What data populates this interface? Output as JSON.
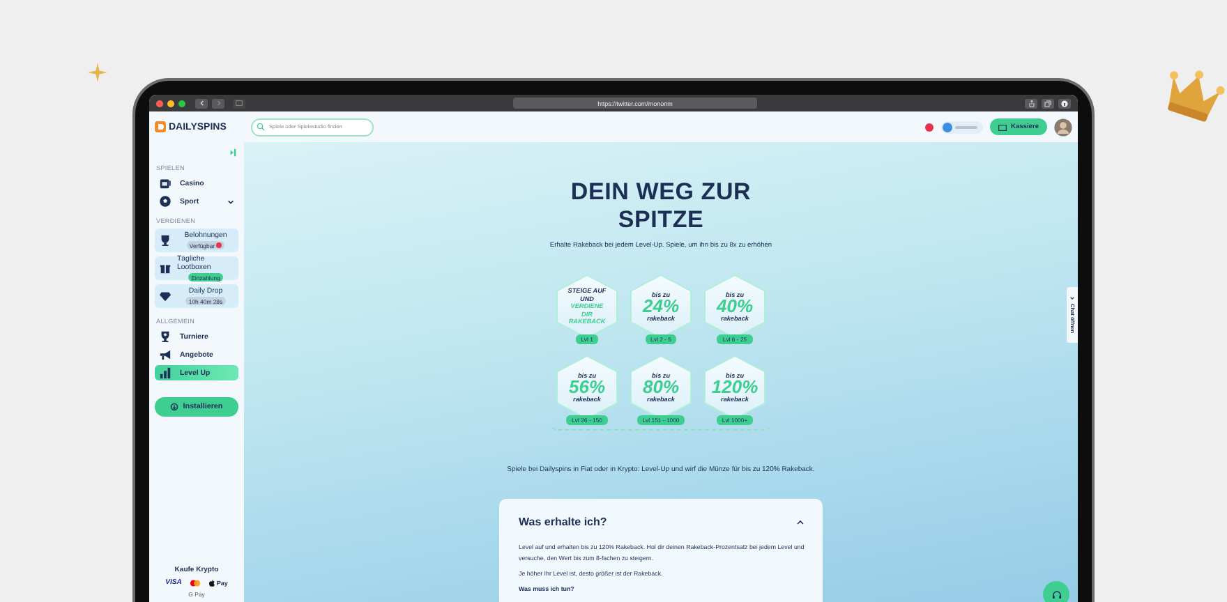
{
  "browser": {
    "url": "https://twitter.com/mononm"
  },
  "logo": {
    "text": "DAILYSPINS"
  },
  "search": {
    "placeholder": "Spiele oder Spielestudio finden"
  },
  "header": {
    "cashier_button": "Kassiere"
  },
  "sidebar": {
    "sections": [
      {
        "title": "SPIELEN",
        "items": [
          {
            "kind": "link",
            "label": "Casino",
            "selected": false,
            "expandable": false
          },
          {
            "kind": "link",
            "label": "Sport",
            "selected": false,
            "expandable": true
          }
        ]
      },
      {
        "title": "VERDIENEN",
        "items": [
          {
            "kind": "card",
            "label": "Belohnungen",
            "badge": {
              "text": "Verfügbar",
              "kind": "alert"
            },
            "selected": false
          },
          {
            "kind": "card",
            "label": "Tägliche Lootboxen",
            "badge": {
              "text": "Einzahlung",
              "kind": "green"
            },
            "selected": false
          },
          {
            "kind": "card",
            "label": "Daily Drop",
            "badge": {
              "text": "10h 40m 28s",
              "kind": "timer"
            },
            "selected": false
          }
        ]
      },
      {
        "title": "ALLGEMEIN",
        "items": [
          {
            "kind": "link",
            "label": "Turniere",
            "selected": false,
            "expandable": false
          },
          {
            "kind": "link",
            "label": "Angebote",
            "selected": false,
            "expandable": false
          },
          {
            "kind": "link",
            "label": "Level Up",
            "selected": true,
            "expandable": false
          }
        ]
      }
    ],
    "install_button": "Installieren",
    "buy_crypto": {
      "title": "Kaufe Krypto",
      "methods": [
        "VISA",
        "Pay",
        "G Pay"
      ]
    }
  },
  "hero": {
    "title": "DEIN WEG ZUR SPITZE",
    "subtitle": "Erhalte Rakeback bei jedem Level-Up. Spiele, um ihn bis zu 8x zu erhöhen"
  },
  "tiers": [
    {
      "kind": "intro",
      "text": "STEIGE AUF UND",
      "highlight": "VERDIENE DIR RAKEBACK",
      "range": "Lvl 1"
    },
    {
      "kind": "tier",
      "prefix": "bis zu",
      "value": "24%",
      "suffix": "rakeback",
      "range": "Lvl 2 - 5"
    },
    {
      "kind": "tier",
      "prefix": "bis zu",
      "value": "40%",
      "suffix": "rakeback",
      "range": "Lvl 6 - 25"
    },
    {
      "kind": "tier",
      "prefix": "bis zu",
      "value": "56%",
      "suffix": "rakeback",
      "range": "Lvl 26 - 150"
    },
    {
      "kind": "tier",
      "prefix": "bis zu",
      "value": "80%",
      "suffix": "rakeback",
      "range": "Lvl 151 - 1000"
    },
    {
      "kind": "tier",
      "prefix": "bis zu",
      "value": "120%",
      "suffix": "rakeback",
      "range": "Lvl 1000+"
    }
  ],
  "promo_text": "Spiele bei Dailyspins in Fiat oder in Krypto: Level-Up und wirf die Münze für bis zu 120% Rakeback.",
  "faq": {
    "title": "Was erhalte ich?",
    "expanded": true,
    "paragraphs": [
      "Level auf und erhalten bis zu 120% Rakeback. Hol dir deinen Rakeback-Prozentsatz bei jedem Level und versuche, den Wert bis zum 8-fachen zu steigern.",
      "Je höher Ihr Level ist, desto größer ist der Rakeback."
    ],
    "subheading": "Was muss ich tun?"
  },
  "chat_tab": {
    "label": "Chat öffnen"
  }
}
